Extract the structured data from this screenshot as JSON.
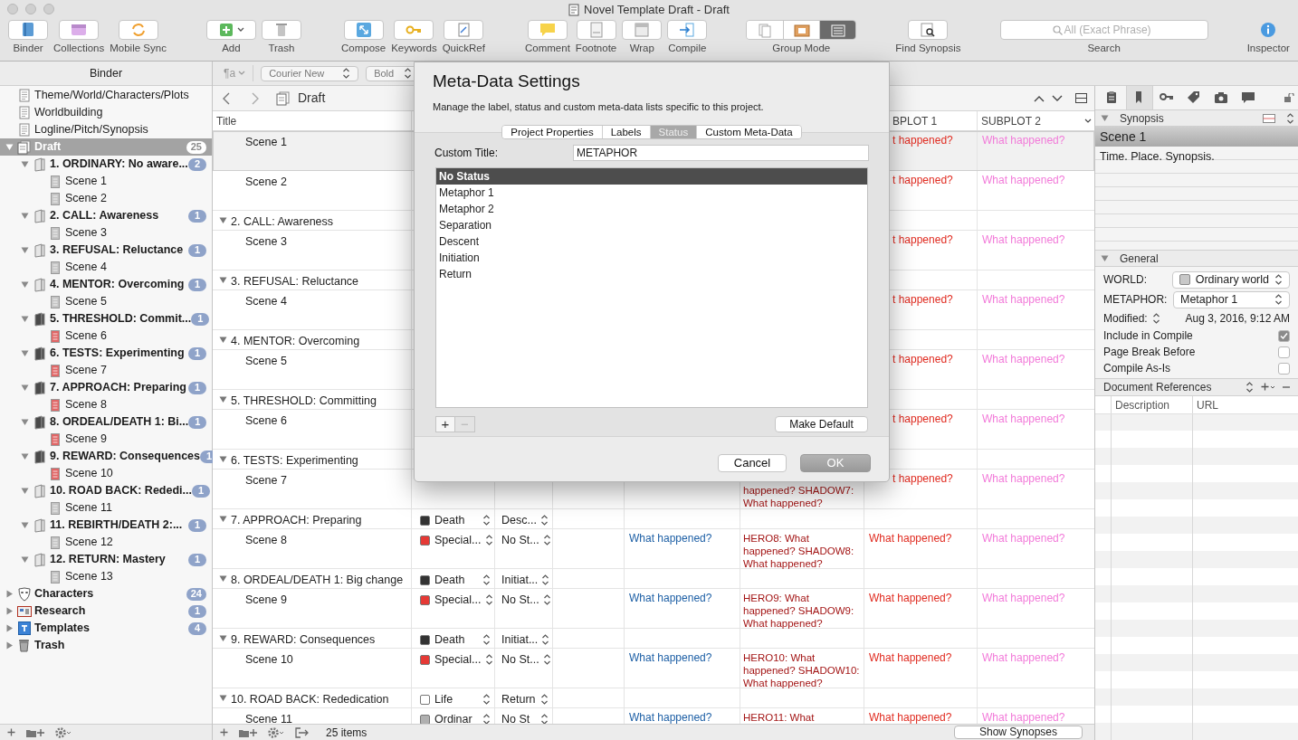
{
  "window": {
    "title": "Novel Template Draft - Draft"
  },
  "toolbar": {
    "groups": [
      [
        {
          "kind": "button",
          "label": "Binder"
        },
        {
          "kind": "button",
          "label": "Collections"
        },
        {
          "kind": "button",
          "label": "Mobile Sync"
        }
      ],
      [
        {
          "kind": "menu-button",
          "label": "Add"
        },
        {
          "kind": "button",
          "label": "Trash"
        }
      ],
      [
        {
          "kind": "button",
          "label": "Compose"
        },
        {
          "kind": "button",
          "label": "Keywords"
        },
        {
          "kind": "button",
          "label": "QuickRef"
        }
      ],
      [
        {
          "kind": "button",
          "label": "Comment"
        },
        {
          "kind": "button",
          "label": "Footnote"
        },
        {
          "kind": "button",
          "label": "Wrap"
        },
        {
          "kind": "button",
          "label": "Compile"
        }
      ],
      [
        {
          "kind": "segmented",
          "label": "Group Mode",
          "segments": [
            {
              "selected": false
            },
            {
              "selected": false
            },
            {
              "selected": true
            }
          ]
        }
      ],
      [
        {
          "kind": "button",
          "label": "Find Synopsis"
        }
      ],
      [
        {
          "kind": "search",
          "label": "Search",
          "placeholder": "All (Exact Phrase)"
        }
      ],
      [
        {
          "kind": "plain-button",
          "label": "Inspector"
        }
      ]
    ]
  },
  "binder": {
    "header": "Binder",
    "items": [
      {
        "kind": "doc",
        "title": "Theme/World/Characters/Plots",
        "selected": false
      },
      {
        "kind": "doc",
        "title": "Worldbuilding",
        "selected": false
      },
      {
        "kind": "doc",
        "title": "Logline/Pitch/Synopsis",
        "selected": false
      },
      {
        "kind": "draft",
        "title": "Draft",
        "count": "25",
        "expanded": true,
        "selected": true,
        "children": [
          {
            "kind": "folder",
            "title": "1. ORDINARY: No aware...",
            "count": "2",
            "expanded": true,
            "color": "#e6e6e6",
            "selected": false,
            "children": [
              {
                "kind": "scene",
                "title": "Scene 1",
                "color": "#c4c4c4",
                "selected": false
              },
              {
                "kind": "scene",
                "title": "Scene 2",
                "color": "#c4c4c4",
                "selected": false
              }
            ]
          },
          {
            "kind": "folder",
            "title": "2. CALL: Awareness",
            "count": "1",
            "expanded": true,
            "color": "#e6e6e6",
            "selected": false,
            "children": [
              {
                "kind": "scene",
                "title": "Scene 3",
                "color": "#c4c4c4",
                "selected": false
              }
            ]
          },
          {
            "kind": "folder",
            "title": "3. REFUSAL: Reluctance",
            "count": "1",
            "expanded": true,
            "color": "#e6e6e6",
            "selected": false,
            "children": [
              {
                "kind": "scene",
                "title": "Scene 4",
                "color": "#c4c4c4",
                "selected": false
              }
            ]
          },
          {
            "kind": "folder",
            "title": "4. MENTOR: Overcoming",
            "count": "1",
            "expanded": true,
            "color": "#e6e6e6",
            "selected": false,
            "children": [
              {
                "kind": "scene",
                "title": "Scene 5",
                "color": "#c4c4c4",
                "selected": false
              }
            ]
          },
          {
            "kind": "folder",
            "title": "5. THRESHOLD: Commit...",
            "count": "1",
            "expanded": true,
            "color": "#4a4a4a",
            "selected": false,
            "children": [
              {
                "kind": "scene",
                "title": "Scene 6",
                "color": "#e06666",
                "selected": false
              }
            ]
          },
          {
            "kind": "folder",
            "title": "6. TESTS: Experimenting",
            "count": "1",
            "expanded": true,
            "color": "#4a4a4a",
            "selected": false,
            "children": [
              {
                "kind": "scene",
                "title": "Scene 7",
                "color": "#e06666",
                "selected": false
              }
            ]
          },
          {
            "kind": "folder",
            "title": "7. APPROACH: Preparing",
            "count": "1",
            "expanded": true,
            "color": "#4a4a4a",
            "selected": false,
            "children": [
              {
                "kind": "scene",
                "title": "Scene 8",
                "color": "#e06666",
                "selected": false
              }
            ]
          },
          {
            "kind": "folder",
            "title": "8. ORDEAL/DEATH 1: Bi...",
            "count": "1",
            "expanded": true,
            "color": "#4a4a4a",
            "selected": false,
            "children": [
              {
                "kind": "scene",
                "title": "Scene 9",
                "color": "#e06666",
                "selected": false
              }
            ]
          },
          {
            "kind": "folder",
            "title": "9. REWARD: Consequences",
            "count": "1",
            "expanded": true,
            "color": "#4a4a4a",
            "selected": false,
            "children": [
              {
                "kind": "scene",
                "title": "Scene 10",
                "color": "#e06666",
                "selected": false
              }
            ]
          },
          {
            "kind": "folder",
            "title": "10. ROAD BACK: Rededi...",
            "count": "1",
            "expanded": true,
            "color": "#e6e6e6",
            "selected": false,
            "children": [
              {
                "kind": "scene",
                "title": "Scene 11",
                "color": "#c4c4c4",
                "selected": false
              }
            ]
          },
          {
            "kind": "folder",
            "title": "11. REBIRTH/DEATH 2:...",
            "count": "1",
            "expanded": true,
            "color": "#e6e6e6",
            "selected": false,
            "children": [
              {
                "kind": "scene",
                "title": "Scene 12",
                "color": "#c4c4c4",
                "selected": false
              }
            ]
          },
          {
            "kind": "folder",
            "title": "12. RETURN: Mastery",
            "count": "1",
            "expanded": true,
            "color": "#e6e6e6",
            "selected": false,
            "children": [
              {
                "kind": "scene",
                "title": "Scene 13",
                "color": "#c4c4c4",
                "selected": false
              }
            ]
          }
        ]
      },
      {
        "kind": "characters",
        "title": "Characters",
        "count": "24",
        "expanded": false,
        "selected": false
      },
      {
        "kind": "research",
        "title": "Research",
        "count": "1",
        "expanded": false,
        "selected": false
      },
      {
        "kind": "templates",
        "title": "Templates",
        "count": "4",
        "expanded": false,
        "selected": false
      },
      {
        "kind": "trash",
        "title": "Trash",
        "expanded": false,
        "selected": false
      }
    ]
  },
  "format_bar": {
    "paragraph_style": "¶a",
    "font": "Courier New",
    "weight": "Bold"
  },
  "editor": {
    "title": "Draft"
  },
  "outline": {
    "title_header": "Title",
    "subplot_1_header": "BPLOT 1",
    "subplot_2_header": "SUBPLOT 2",
    "rows": [
      {
        "kind": "scene",
        "title": "Scene 1",
        "selected": true,
        "subplot_1": "t happened?",
        "subplot_2": "What happened?"
      },
      {
        "kind": "scene",
        "title": "Scene 2",
        "selected": false,
        "subplot_1": "t happened?",
        "subplot_2": "What happened?"
      },
      {
        "kind": "group",
        "title": "2. CALL: Awareness",
        "expanded": true,
        "selected": false
      },
      {
        "kind": "scene",
        "title": "Scene 3",
        "selected": false,
        "subplot_1": "t happened?",
        "subplot_2": "What happened?"
      },
      {
        "kind": "group",
        "title": "3. REFUSAL: Reluctance",
        "expanded": true,
        "selected": false
      },
      {
        "kind": "scene",
        "title": "Scene 4",
        "selected": false,
        "subplot_1": "t happened?",
        "subplot_2": "What happened?"
      },
      {
        "kind": "group",
        "title": "4. MENTOR: Overcoming",
        "expanded": true,
        "selected": false
      },
      {
        "kind": "scene",
        "title": "Scene 5",
        "selected": false,
        "subplot_1": "t happened?",
        "subplot_2": "What happened?"
      },
      {
        "kind": "group",
        "title": "5. THRESHOLD: Committing",
        "expanded": true,
        "selected": false
      },
      {
        "kind": "scene",
        "title": "Scene 6",
        "selected": false,
        "subplot_1": "t happened?",
        "subplot_2": "What happened?"
      },
      {
        "kind": "group",
        "title": "6. TESTS: Experimenting",
        "expanded": true,
        "selected": false
      },
      {
        "kind": "scene",
        "title": "Scene 7",
        "selected": false,
        "column_6": "happened? SHADOW7: What happened?",
        "subplot_1": "t happened?",
        "subplot_2": "What happened?"
      },
      {
        "kind": "group",
        "title": "7. APPROACH: Preparing",
        "expanded": true,
        "selected": false,
        "label": {
          "text": "Death",
          "color": "#333333"
        },
        "status": "Desc..."
      },
      {
        "kind": "scene",
        "title": "Scene 8",
        "selected": false,
        "label": {
          "text": "Special...",
          "color": "#e53935"
        },
        "status": "No St...",
        "column_5": "What happened?",
        "column_6": "HERO8: What happened? SHADOW8: What happened?",
        "subplot_1": "What happened?",
        "subplot_2": "What happened?"
      },
      {
        "kind": "group",
        "title": "8. ORDEAL/DEATH 1: Big change",
        "expanded": true,
        "selected": false,
        "label": {
          "text": "Death",
          "color": "#333333"
        },
        "status": "Initiat..."
      },
      {
        "kind": "scene",
        "title": "Scene 9",
        "selected": false,
        "label": {
          "text": "Special...",
          "color": "#e53935"
        },
        "status": "No St...",
        "column_5": "What happened?",
        "column_6": "HERO9: What happened? SHADOW9: What happened?",
        "subplot_1": "What happened?",
        "subplot_2": "What happened?"
      },
      {
        "kind": "group",
        "title": "9. REWARD: Consequences",
        "expanded": true,
        "selected": false,
        "label": {
          "text": "Death",
          "color": "#333333"
        },
        "status": "Initiat..."
      },
      {
        "kind": "scene",
        "title": "Scene 10",
        "selected": false,
        "label": {
          "text": "Special...",
          "color": "#e53935"
        },
        "status": "No St...",
        "column_5": "What happened?",
        "column_6": "HERO10: What happened? SHADOW10: What happened?",
        "subplot_1": "What happened?",
        "subplot_2": "What happened?"
      },
      {
        "kind": "group",
        "title": "10. ROAD BACK: Rededication",
        "expanded": true,
        "selected": false,
        "label": {
          "text": "Life",
          "color": "#ffffff"
        },
        "status": "Return"
      },
      {
        "kind": "scene",
        "title": "Scene 11",
        "selected": false,
        "label": {
          "text": "Ordinar",
          "color": "#b0b0b0"
        },
        "status": "No St",
        "column_5": "What happened?",
        "column_6": "HERO11: What",
        "subplot_1": "What happened?",
        "subplot_2": "What happened?"
      }
    ]
  },
  "editor_footer": {
    "count": "25 items",
    "show_synopses": "Show Synopses"
  },
  "inspector": {
    "tabs": [
      {
        "selected": false
      },
      {
        "selected": true
      },
      {
        "selected": false
      },
      {
        "selected": false
      },
      {
        "selected": false
      },
      {
        "selected": false
      }
    ],
    "synopsis": {
      "header": "Synopsis",
      "expanded": true,
      "title": "Scene 1",
      "text": "Time. Place. Synopsis."
    },
    "general": {
      "header": "General",
      "expanded": true,
      "fields": [
        {
          "kind": "popup",
          "label": "WORLD:",
          "value": "Ordinary world",
          "color": "#c8c8c8"
        },
        {
          "kind": "popup",
          "label": "METAPHOR:",
          "value": "Metaphor 1"
        },
        {
          "kind": "date",
          "label": "Modified:",
          "value": "Aug 3, 2016, 9:12 AM"
        },
        {
          "kind": "checkbox",
          "label": "Include in Compile",
          "checked": true
        },
        {
          "kind": "checkbox",
          "label": "Page Break Before",
          "checked": false
        },
        {
          "kind": "checkbox",
          "label": "Compile As-Is",
          "checked": false
        }
      ]
    },
    "references": {
      "header": "Document References",
      "columns": [
        "Description",
        "URL"
      ]
    }
  },
  "dialog": {
    "title": "Meta-Data Settings",
    "subtitle": "Manage the label, status and custom meta-data lists specific to this project.",
    "tabs": [
      {
        "label": "Project Properties",
        "selected": false
      },
      {
        "label": "Labels",
        "selected": false
      },
      {
        "label": "Status",
        "selected": true
      },
      {
        "label": "Custom Meta-Data",
        "selected": false
      }
    ],
    "custom_title_label": "Custom Title:",
    "custom_title": "METAPHOR",
    "items": [
      {
        "text": "No Status",
        "selected": true
      },
      {
        "text": "Metaphor 1",
        "selected": false
      },
      {
        "text": "Metaphor 2",
        "selected": false
      },
      {
        "text": "Separation",
        "selected": false
      },
      {
        "text": "Descent",
        "selected": false
      },
      {
        "text": "Initiation",
        "selected": false
      },
      {
        "text": "Return",
        "selected": false
      }
    ],
    "add_button": {
      "text": "+",
      "disabled": false
    },
    "remove_button": {
      "text": "−",
      "disabled": true
    },
    "make_default": "Make Default",
    "cancel": "Cancel",
    "ok": "OK"
  }
}
